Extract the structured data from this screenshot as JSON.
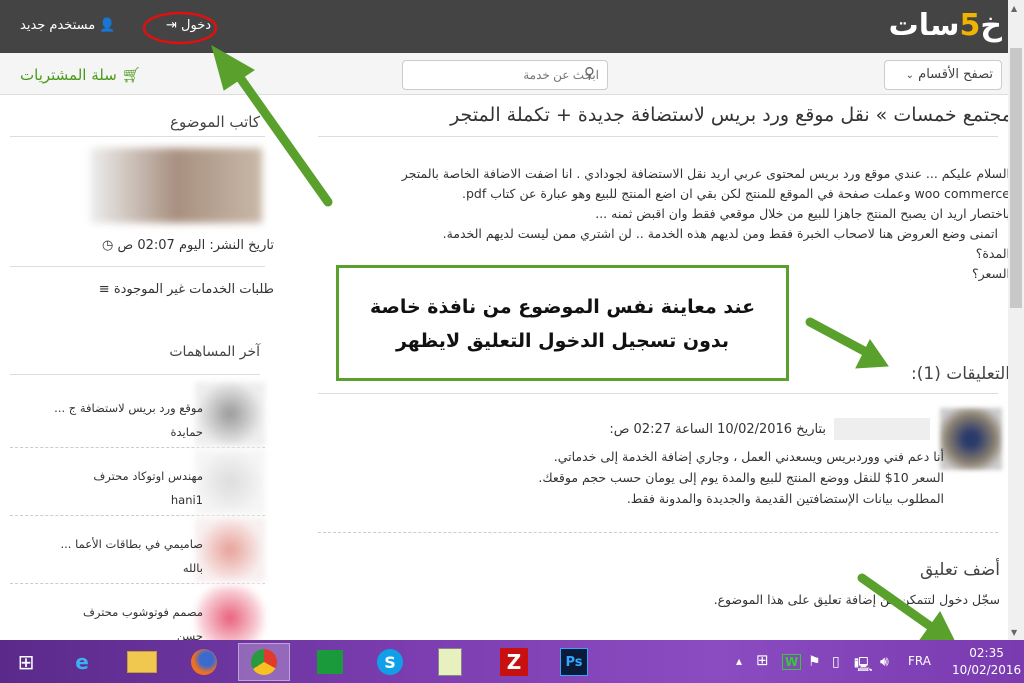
{
  "header": {
    "logo": "خمسات",
    "login": "دخول",
    "new_user": "مستخدم جديد"
  },
  "subbar": {
    "browse": "تصفح الأقسام",
    "search_placeholder": "ابحث عن خدمة",
    "cart": "سلة المشتريات"
  },
  "post": {
    "title": "مجتمع خمسات » نقل موقع ورد بريس لاستضافة جديدة + تكملة المتجر",
    "lines": [
      "السلام عليكم ... عندي موقع ورد بريس لمحتوى عربي اريد نقل الاستضافة لجودادي . انا اضفت الاضافة الخاصة بالمتجر",
      "woo commerce وعملت صفحة في الموقع للمنتج لكن بقي ان اضع المنتج للبيع وهو عبارة عن كتاب pdf.",
      "باختصار اريد ان يصبح المنتج جاهزا للبيع من خلال موقعي فقط وان اقبض ثمنه ...",
      "اتمنى وضع العروض هنا لاصحاب الخبرة فقط ومن لديهم هذه الخدمة .. لن اشتري ممن ليست لديهم الخدمة.",
      "المدة؟",
      "السعر؟"
    ]
  },
  "comments": {
    "heading": "التعليقات (1):",
    "items": [
      {
        "meta": "بتاريخ 10/02/2016 الساعة 02:27 ص:",
        "lines": [
          "أنا دعم فني ووردبريس ويسعدني العمل ، وجاري إضافة الخدمة إلى خدماتي.",
          "السعر 10$ للنقل ووضع المنتج للبيع والمدة يوم إلى يومان حسب حجم موقعك.",
          "المطلوب بيانات الإستضافتين القديمة والجديدة والمدونة فقط."
        ]
      }
    ]
  },
  "add_comment": {
    "heading": "أضف تعليق",
    "note": "سجّل دخول لتتمكن من إضافة تعليق على هذا الموضوع."
  },
  "sidebar": {
    "author_heading": "كاتب الموضوع",
    "published": "تاريخ النشر: اليوم 02:07 ص",
    "requests_link": "طلبات الخدمات غير الموجودة",
    "recent_heading": "آخر المساهمات",
    "recent": [
      {
        "title": "موقع ورد بريس لاستضافة ج ...",
        "user": "حمايدة"
      },
      {
        "title": "مهندس اوتوكاد محترف",
        "user": "hani1"
      },
      {
        "title": "صاميمي في بطاقات الأعما ...",
        "user": "بالله"
      },
      {
        "title": "مصمم فوتوشوب محترف",
        "user": "حسن"
      }
    ]
  },
  "annotation": {
    "line1": "عند معاينة نفس الموضوع من نافذة خاصة",
    "line2": "بدون تسجيل الدخول التعليق لايظهر"
  },
  "taskbar": {
    "language": "FRA",
    "time": "02:35",
    "date": "10/02/2016"
  },
  "colors": {
    "header": "#444444",
    "accent": "#4a9a18",
    "annotation": "#5aa02c",
    "taskbar": "#7b3db0"
  }
}
